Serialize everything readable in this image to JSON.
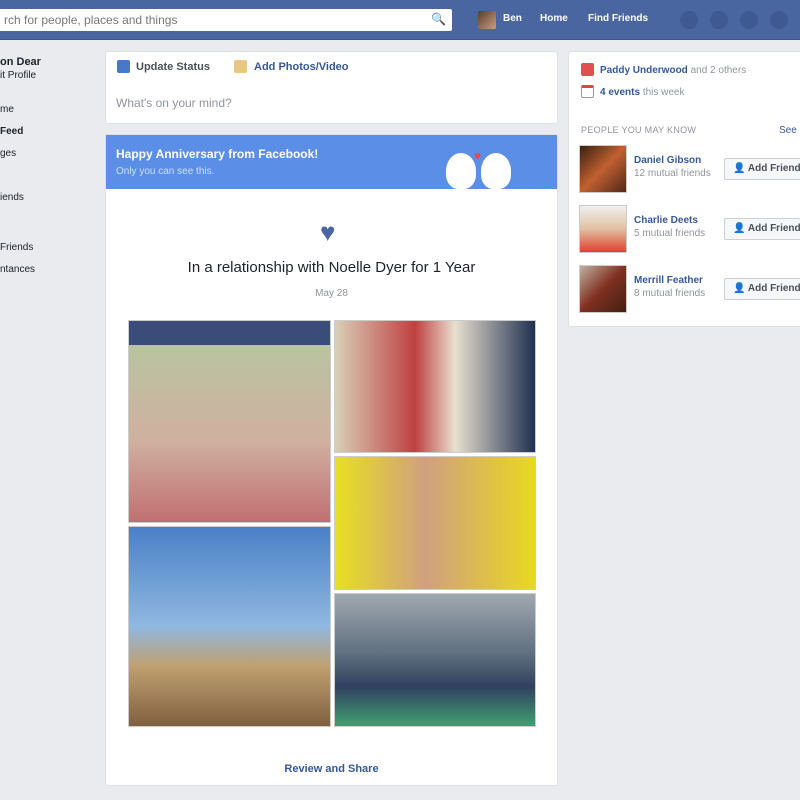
{
  "topbar": {
    "search_placeholder": "rch for people, places and things",
    "user": "Ben",
    "home": "Home",
    "find_friends": "Find Friends"
  },
  "sidebar": {
    "name": "on Dear",
    "edit": "it Profile",
    "items": [
      "me",
      "Feed",
      "ges",
      "",
      "iends",
      "Friends",
      "ntances"
    ]
  },
  "composer": {
    "update_status": "Update Status",
    "add_photos": "Add Photos/Video",
    "placeholder": "What's on your mind?"
  },
  "anniversary": {
    "banner_title": "Happy Anniversary from Facebook!",
    "banner_sub": "Only you can see this.",
    "headline": "In a relationship with Noelle Dyer for 1 Year",
    "date": "May 28",
    "action": "Review and Share",
    "accent": "#5b8ee6"
  },
  "right": {
    "birthday_name": "Paddy Underwood",
    "birthday_rest": "and 2 others",
    "events": "4 events",
    "events_rest": "this week",
    "pymk_title": "PEOPLE YOU MAY KNOW",
    "see_all": "See",
    "people": [
      {
        "name": "Daniel Gibson",
        "mutual": "12 mutual friends",
        "button": "Add Friend"
      },
      {
        "name": "Charlie Deets",
        "mutual": "5 mutual friends",
        "button": "Add Friend"
      },
      {
        "name": "Merrill Feather",
        "mutual": "8 mutual friends",
        "button": "Add Friend"
      }
    ]
  }
}
